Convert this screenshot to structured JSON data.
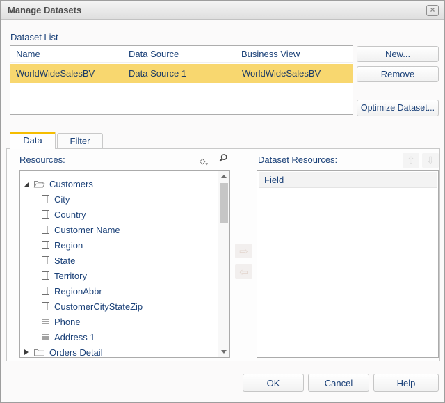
{
  "dialog": {
    "title": "Manage Datasets"
  },
  "dataset_list": {
    "label": "Dataset List",
    "columns": [
      "Name",
      "Data Source",
      "Business View"
    ],
    "rows": [
      {
        "name": "WorldWideSalesBV",
        "data_source": "Data Source 1",
        "business_view": "WorldWideSalesBV",
        "selected": true
      }
    ]
  },
  "actions": {
    "new": "New...",
    "remove": "Remove",
    "optimize": "Optimize Dataset..."
  },
  "tabs": [
    {
      "label": "Data",
      "active": true
    },
    {
      "label": "Filter",
      "active": false
    }
  ],
  "resources": {
    "label": "Resources:",
    "tree": [
      {
        "icon": "folder-open",
        "expander": "expanded",
        "label": "Customers",
        "level": 0
      },
      {
        "icon": "field",
        "label": "City",
        "level": 1
      },
      {
        "icon": "field",
        "label": "Country",
        "level": 1
      },
      {
        "icon": "field",
        "label": "Customer Name",
        "level": 1
      },
      {
        "icon": "field",
        "label": "Region",
        "level": 1
      },
      {
        "icon": "field",
        "label": "State",
        "level": 1
      },
      {
        "icon": "field",
        "label": "Territory",
        "level": 1
      },
      {
        "icon": "field",
        "label": "RegionAbbr",
        "level": 1
      },
      {
        "icon": "field",
        "label": "CustomerCityStateZip",
        "level": 1
      },
      {
        "icon": "lines",
        "label": "Phone",
        "level": 1
      },
      {
        "icon": "lines",
        "label": "Address 1",
        "level": 1
      },
      {
        "icon": "folder-closed",
        "expander": "collapsed",
        "label": "Orders Detail",
        "level": 0
      }
    ]
  },
  "dataset_resources": {
    "label": "Dataset Resources:",
    "columns": [
      "Field"
    ],
    "rows": []
  },
  "footer": {
    "ok": "OK",
    "cancel": "Cancel",
    "help": "Help"
  },
  "colors": {
    "accent_gold": "#F5BD00",
    "selection_amber": "#F8D76F",
    "text_navy": "#1B4178",
    "title_gray": "#4D4D4D"
  }
}
